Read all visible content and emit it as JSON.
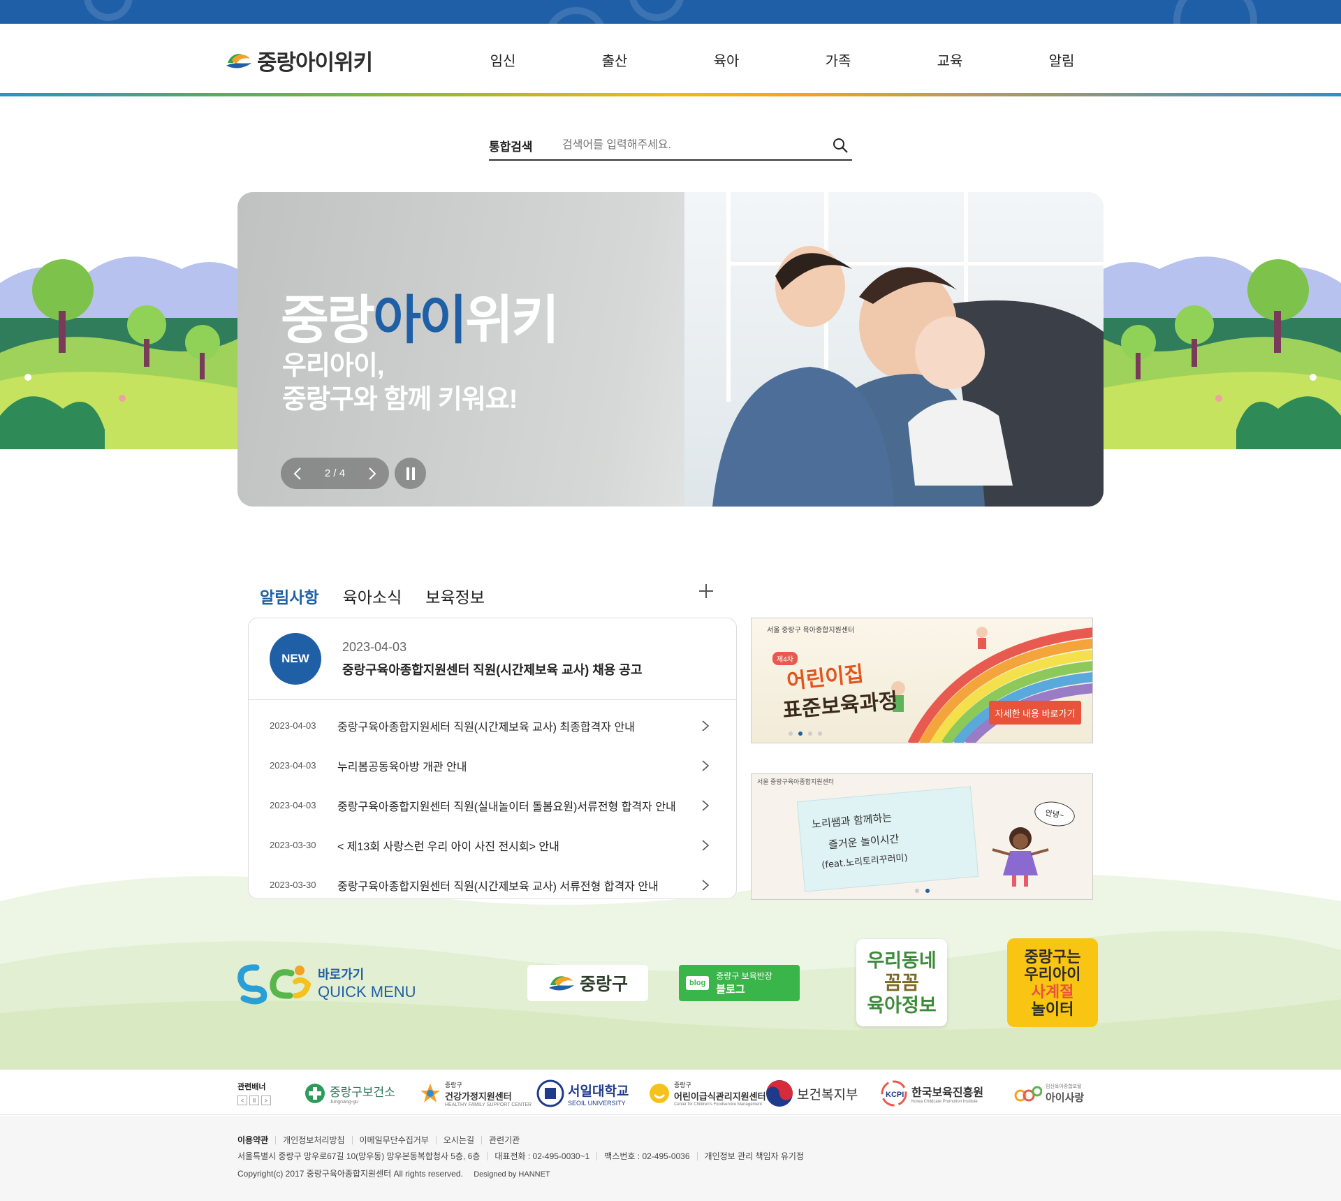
{
  "site": {
    "logo_text": "중랑아이위키"
  },
  "nav": {
    "items": [
      "임신",
      "출산",
      "육아",
      "가족",
      "교육",
      "알림"
    ]
  },
  "search": {
    "label": "통합검색",
    "placeholder": "검색어를 입력해주세요."
  },
  "hero": {
    "title_part1": "중랑",
    "title_accent": "아이",
    "title_part2": "위키",
    "subtitle_line1": "우리아이,",
    "subtitle_line2": "중랑구와 함께 키워요!",
    "slide_current": "2",
    "slide_separator": "/",
    "slide_total": "4"
  },
  "board": {
    "tabs": [
      "알림사항",
      "육아소식",
      "보육정보"
    ],
    "active_tab": 0,
    "featured": {
      "badge": "NEW",
      "date": "2023-04-03",
      "title": "중랑구육아종합지원센터 직원(시간제보육 교사) 채용 공고"
    },
    "items": [
      {
        "date": "2023-04-03",
        "title": "중랑구육아종합지원세터 직원(시간제보육 교사) 최종합격자 안내"
      },
      {
        "date": "2023-04-03",
        "title": "누리봄공동육아방 개관 안내"
      },
      {
        "date": "2023-04-03",
        "title": "중랑구육아종합지원센터 직원(실내놀이터 돌봄요원)서류전형 합격자 안내"
      },
      {
        "date": "2023-03-30",
        "title": "< 제13회 사랑스런 우리 아이 사진 전시회> 안내"
      },
      {
        "date": "2023-03-30",
        "title": "중랑구육아종합지원센터 직원(시간제보육 교사) 서류전형 합격자 안내"
      }
    ]
  },
  "banners": {
    "banner1": {
      "org": "서울 중랑구 육아종합지원센터",
      "badge": "제4차",
      "title_line1": "어린이집",
      "title_line2": "표준보육과정",
      "button": "자세한 내용 바로가기"
    },
    "banner2": {
      "org": "서울 중랑구육아종합지원센터",
      "line1": "노리쌤과 함께하는",
      "line2": "즐거운 놀이시간",
      "line3": "(feat.노리토리꾸러미)",
      "bubble": "안녕~"
    }
  },
  "quick": {
    "label1": "바로가기",
    "label2": "QUICK MENU",
    "junglang": "중랑구",
    "blog_tag": "blog",
    "blog_line1": "중랑구 보육반장",
    "blog_line2": "블로그",
    "info_line1": "우리동네",
    "info_line2": "꼼꼼",
    "info_line3": "육아정보",
    "play_line1": "중랑구는",
    "play_line2": "우리아이",
    "play_line3": "사계절",
    "play_line4": "놀이터"
  },
  "related": {
    "label": "관련배너",
    "partners": [
      {
        "name": "중랑구보건소",
        "sub": "Jungnang-gu"
      },
      {
        "name": "건강가정지원센터",
        "sub": "HEALTHY FAMILY SUPPORT CENTER",
        "pre": "중랑구"
      },
      {
        "name": "서일대학교",
        "sub": "SEOIL UNIVERSITY"
      },
      {
        "name": "어린이급식관리지원센터",
        "sub": "Center for Children's Foodservice Management",
        "pre": "중랑구"
      },
      {
        "name": "보건복지부",
        "sub": ""
      },
      {
        "name": "한국보육진흥원",
        "sub": "Korea Childcare Promotion Institute"
      },
      {
        "name": "아이사랑",
        "sub": "임신육아종합포털"
      }
    ]
  },
  "footer": {
    "links": [
      "이용약관",
      "개인정보처리방침",
      "이메일무단수집거부",
      "오시는길",
      "관련기관"
    ],
    "address": "서울특별시 중랑구 망우로67길 10(망우동) 망우본동복합청사 5층, 6층",
    "phone": "대표전화 : 02-495-0030~1",
    "fax": "팩스번호 : 02-495-0036",
    "manager": "개인정보 관리 책임자 유기정",
    "copyright": "Copyright(c) 2017 중랑구육아종합지원센터 All rights reserved.",
    "designed": "Designed by HANNET"
  },
  "colors": {
    "brand_blue": "#1e5fa6",
    "top_strip": "#1f5fa8",
    "blog_green": "#3ab54a",
    "play_yellow": "#f9c513",
    "banner_button": "#e8533a"
  }
}
